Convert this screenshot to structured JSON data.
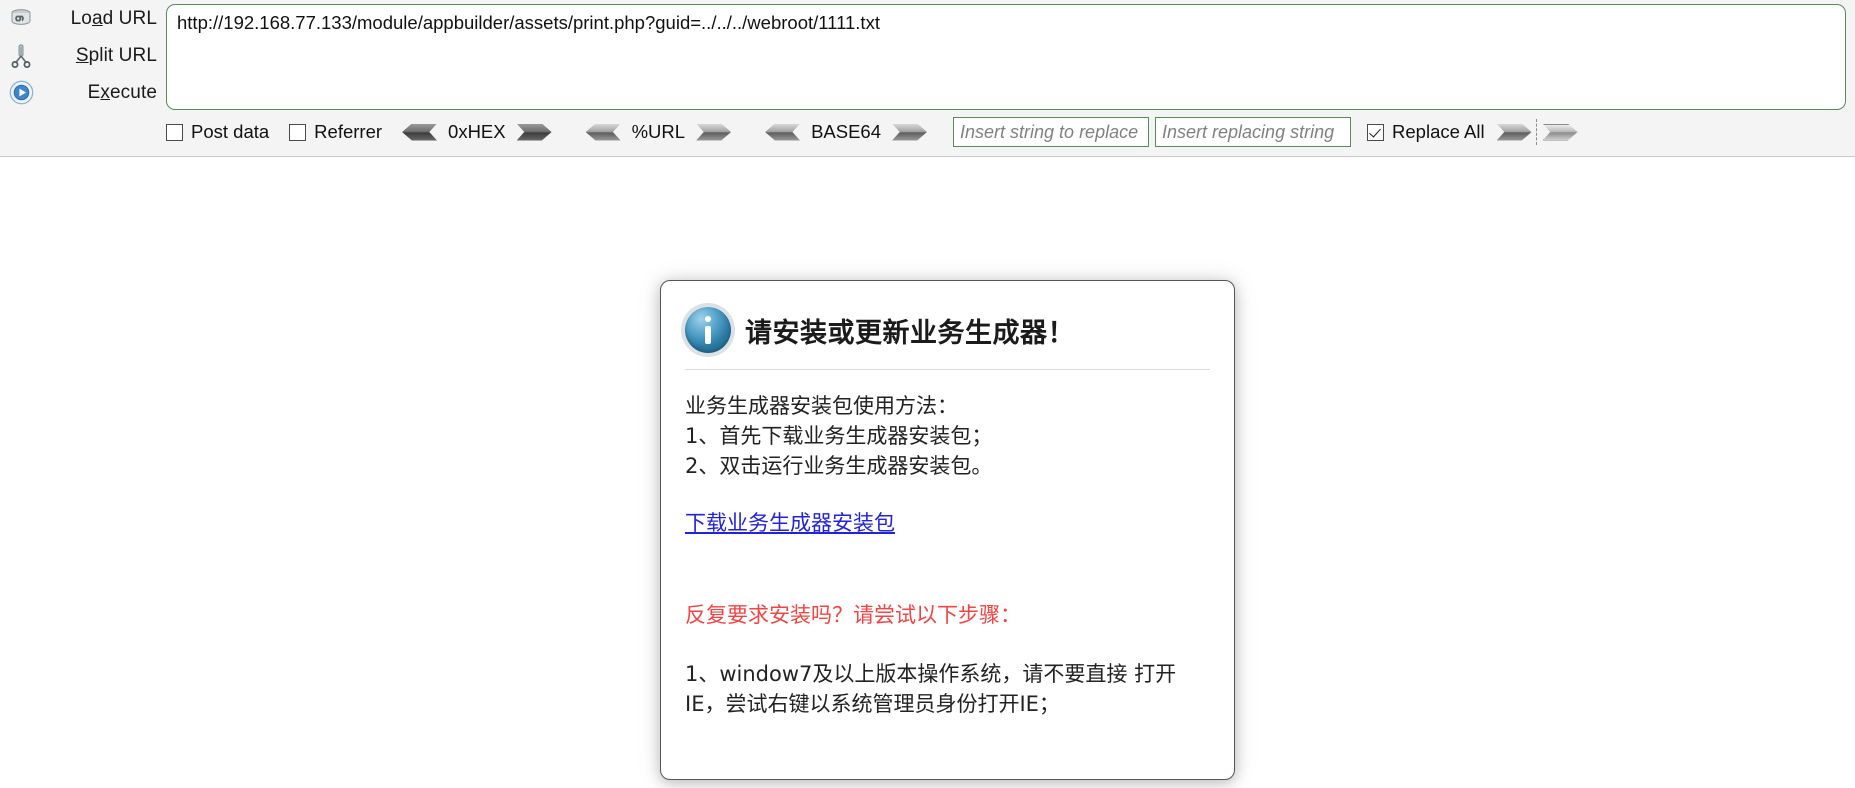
{
  "hackbar": {
    "commands": [
      {
        "label_pre": "Lo",
        "label_accel": "a",
        "label_post": "d URL",
        "icon": "load-url-icon"
      },
      {
        "label_pre": "",
        "label_accel": "S",
        "label_post": "plit URL",
        "icon": "scissors-icon"
      },
      {
        "label_pre": "E",
        "label_accel": "x",
        "label_post": "ecute",
        "icon": "play-circle-icon"
      }
    ],
    "commands_plain": [
      "Load URL",
      "Split URL",
      "Execute"
    ],
    "url_value": "http://192.168.77.133/module/appbuilder/assets/print.php?guid=../../../webroot/1111.txt",
    "checkboxes": [
      {
        "label": "Post data",
        "checked": false
      },
      {
        "label": "Referrer",
        "checked": false
      },
      {
        "label": "Replace All",
        "checked": true
      }
    ],
    "encoders": [
      {
        "label": "0xHEX"
      },
      {
        "label": "%URL"
      },
      {
        "label": "BASE64"
      }
    ],
    "replace_inputs": [
      {
        "placeholder": "Insert string to replace",
        "value": ""
      },
      {
        "placeholder": "Insert replacing string",
        "value": ""
      }
    ],
    "accent_border": "#5a8a5a"
  },
  "dialog": {
    "title": "请安装或更新业务生成器！",
    "icon": "info-icon",
    "body_lines": [
      "业务生成器安装包使用方法：",
      "1、首先下载业务生成器安装包；",
      "2、双击运行业务生成器安装包。"
    ],
    "download_link": "下载业务生成器安装包",
    "warning": "反复要求安装吗？请尝试以下步骤：",
    "warning_color": "#f04545",
    "steps_lines": [
      "1、window7及以上版本操作系统，请不要直接",
      "打开IE，尝试右键以系统管理员身份打开IE；"
    ]
  }
}
